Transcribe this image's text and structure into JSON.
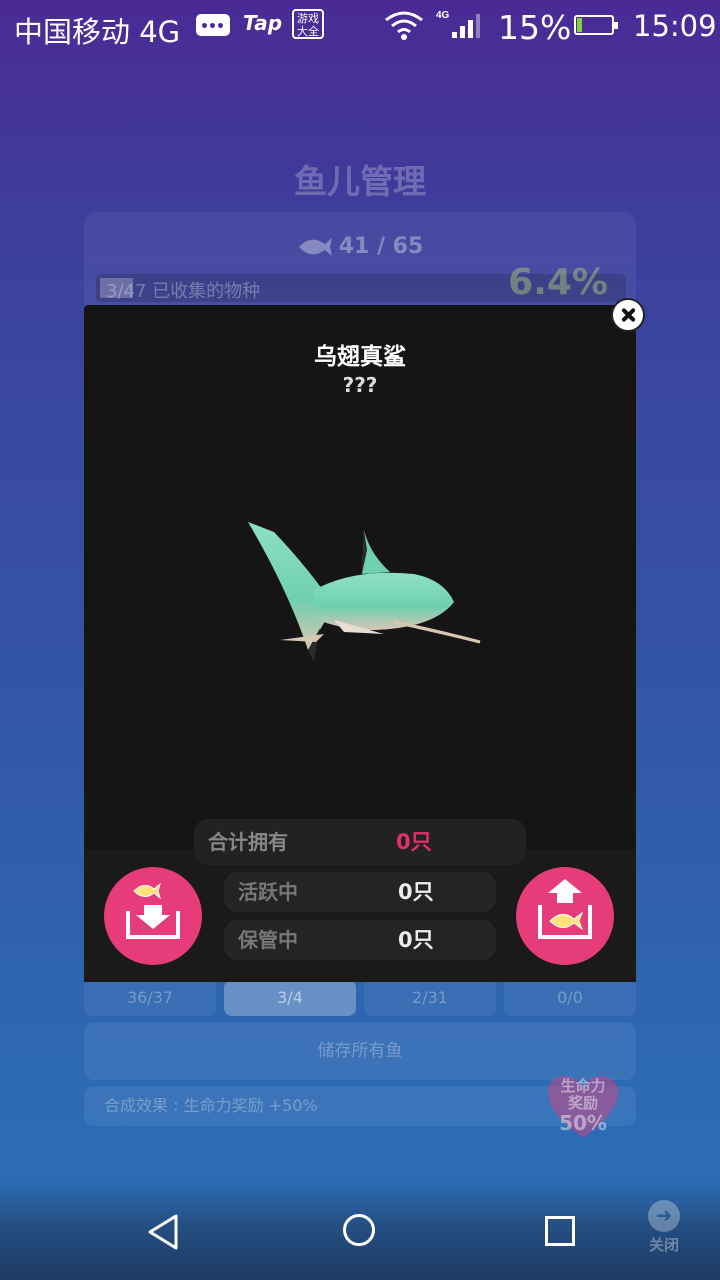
{
  "status_bar": {
    "carrier": "中国移动 4G",
    "tap_label": "Tap",
    "game_badge": "游戏大全",
    "network_badge": "4G",
    "battery_pct": "15%",
    "time": "15:09",
    "battery_level": 0.15
  },
  "background_page": {
    "title": "鱼儿管理",
    "fish_count": "41 / 65",
    "collected_label": "3/47 已收集的物种",
    "collected_pct": "6.4%",
    "tabs": [
      "36/37",
      "3/4",
      "2/31",
      "0/0"
    ],
    "active_tab_index": 1,
    "store_all_label": "储存所有鱼",
    "synth_effect": "合成效果 : 生命力奖励 +50%",
    "heart_label_line1": "生命力",
    "heart_label_line2": "奖励",
    "heart_value": "50%"
  },
  "modal": {
    "fish_name": "乌翅真鲨",
    "fish_subtitle": "???",
    "total_label": "合计拥有",
    "total_value": "0只",
    "active_label": "活跃中",
    "active_value": "0只",
    "storage_label": "保管中",
    "storage_value": "0只",
    "accent_color": "#e63d7a",
    "total_value_color": "#e0306e"
  },
  "nav_bar": {
    "close_label": "关闭"
  },
  "icons": [
    "message-icon",
    "wifi-icon",
    "signal-icon",
    "battery-icon",
    "fish-icon",
    "close-icon",
    "store-fish-icon",
    "release-fish-icon",
    "back-icon",
    "home-icon",
    "recent-apps-icon",
    "arrow-right-icon",
    "heart-icon"
  ]
}
